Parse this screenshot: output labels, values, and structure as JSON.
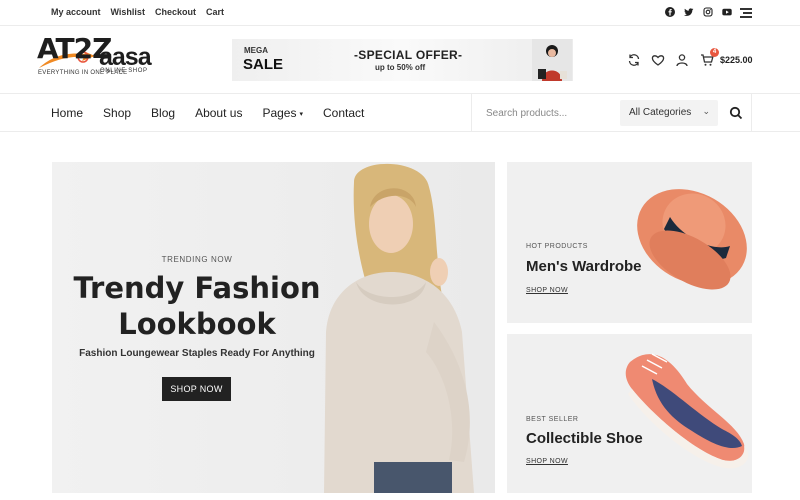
{
  "topbar": {
    "links": [
      "My account",
      "Wishlist",
      "Checkout",
      "Cart"
    ],
    "social_icons": [
      "facebook-icon",
      "twitter-icon",
      "instagram-icon",
      "youtube-icon"
    ],
    "menu_icon": "hamburger-icon"
  },
  "logo": {
    "text_main": "AT2Z",
    "text_second": "aasa",
    "tagline": "EVERYTHING IN ONE PLACE",
    "sub": "ONLINE SHOP"
  },
  "promo_banner": {
    "mega": "MEGA",
    "sale": "SALE",
    "offer": "-SPECIAL OFFER-",
    "discount": "up to 50% off"
  },
  "header_icons": [
    "refresh-icon",
    "heart-icon",
    "user-icon",
    "cart-icon"
  ],
  "cart": {
    "count": "4",
    "total": "$225.00"
  },
  "nav": {
    "items": [
      "Home",
      "Shop",
      "Blog",
      "About us",
      "Pages",
      "Contact"
    ],
    "pages_caret": "▾"
  },
  "search": {
    "placeholder": "Search products...",
    "category": "All Categories"
  },
  "hero": {
    "kicker": "TRENDING NOW",
    "title_line1": "Trendy Fashion",
    "title_line2": "Lookbook",
    "description": "Fashion Loungewear Staples Ready For Anything",
    "button": "SHOP NOW"
  },
  "cards": [
    {
      "kicker": "HOT PRODUCTS",
      "title": "Men's Wardrobe",
      "link": "SHOP NOW"
    },
    {
      "kicker": "BEST SELLER",
      "title": "Collectible Shoe",
      "link": "SHOP NOW"
    }
  ],
  "colors": {
    "accent": "#e8573f",
    "dark": "#222222",
    "panel": "#f0f0f0"
  }
}
